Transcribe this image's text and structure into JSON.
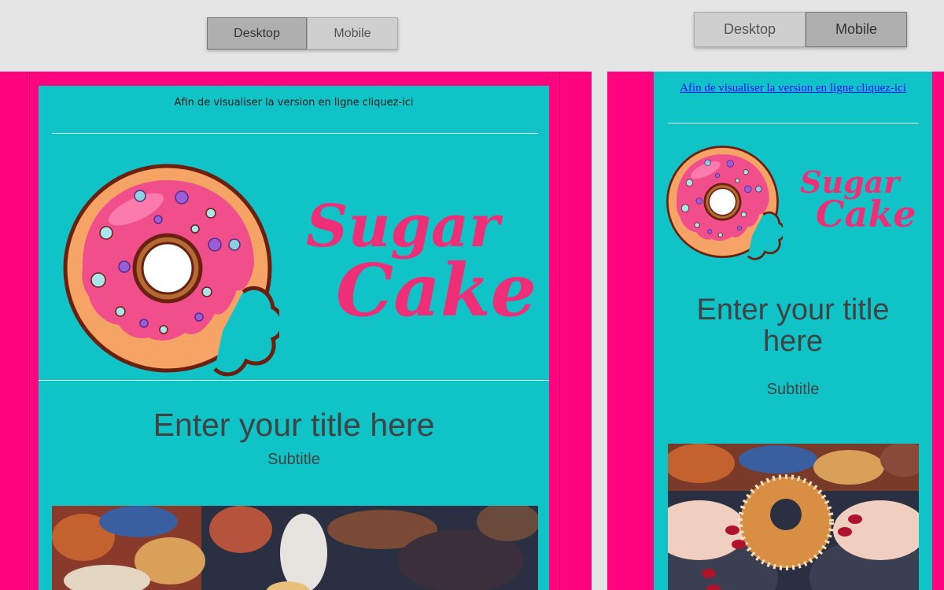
{
  "toggle_desktop_view": {
    "desktop_label": "Desktop",
    "mobile_label": "Mobile",
    "active": "Desktop"
  },
  "toggle_mobile_view": {
    "desktop_label": "Desktop",
    "mobile_label": "Mobile",
    "active": "Mobile"
  },
  "email": {
    "view_online_text": "Afin de visualiser la version en ligne cliquez-ici",
    "logo": {
      "word1": "Sugar",
      "word2": "Cake"
    },
    "title": "Enter your title here",
    "subtitle": "Subtitle"
  },
  "colors": {
    "outer_background": "#ff047f",
    "email_background": "#10c3c6",
    "logo_pink": "#ee2f78",
    "toolbar_background": "#e5e5e5"
  },
  "images": {
    "logo_icon": "donut-with-bite-icon",
    "hero_photo": "hands-holding-sugar-donut-photo"
  }
}
